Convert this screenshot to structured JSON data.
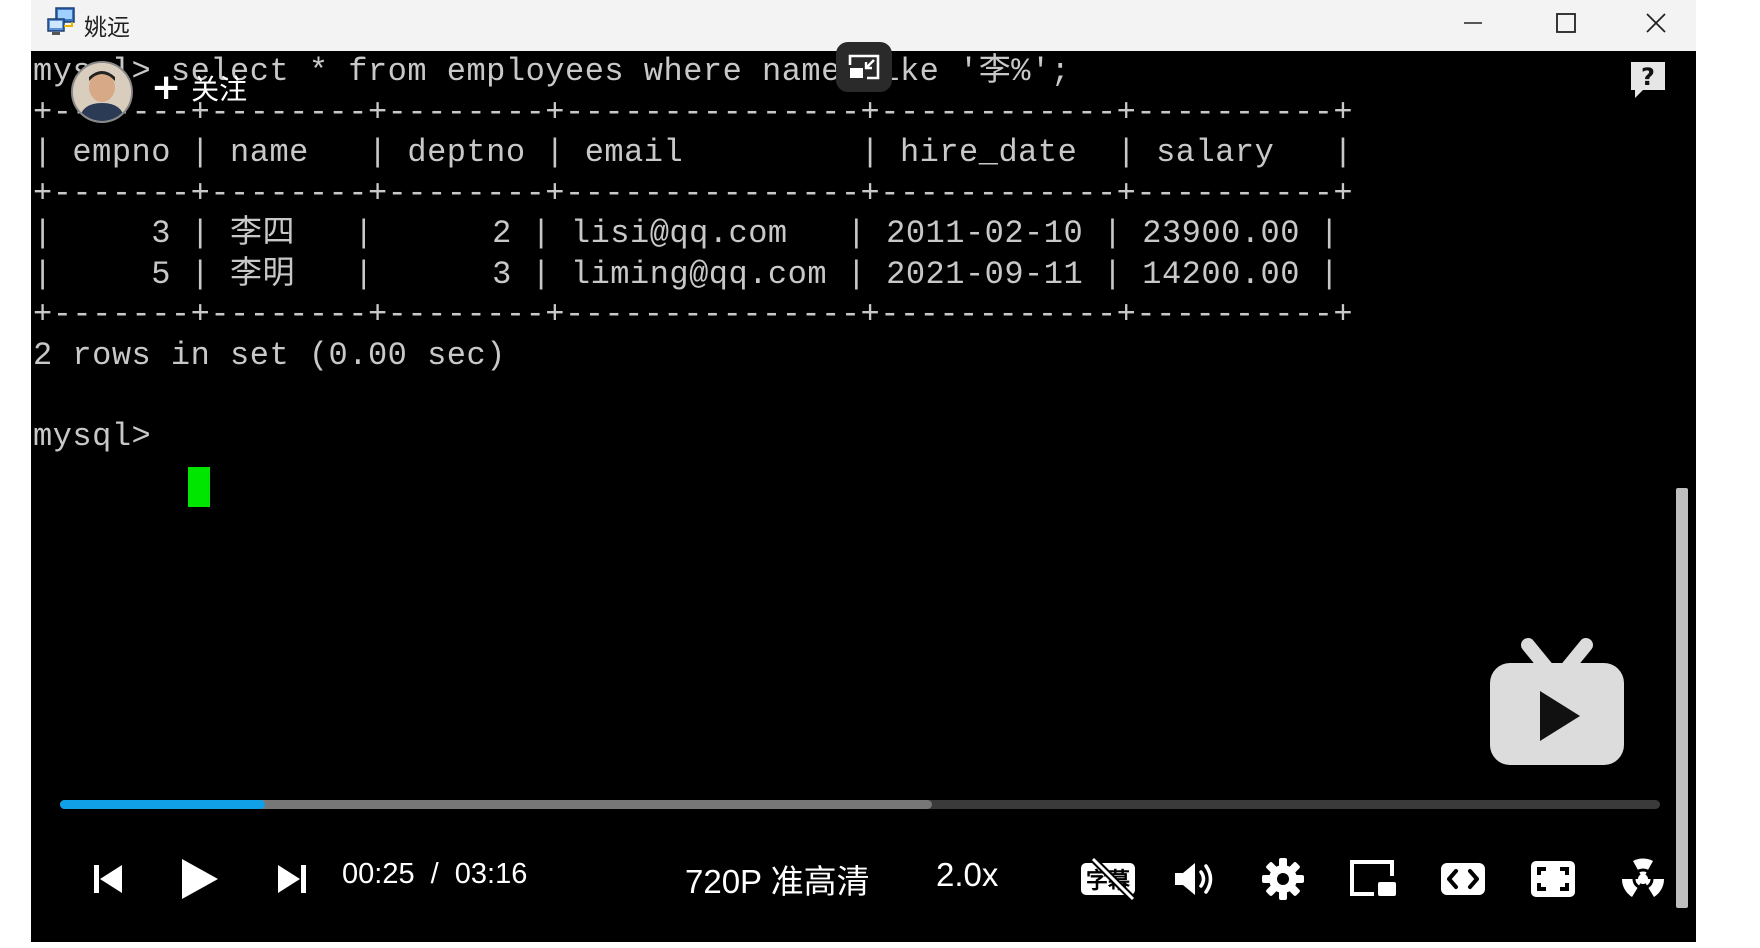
{
  "window": {
    "title": "姚远"
  },
  "terminal": {
    "lines": [
      "mysql> select * from employees where name like '李%';",
      "+-------+--------+--------+---------------+------------+----------+",
      "| empno | name   | deptno | email         | hire_date  | salary   |",
      "+-------+--------+--------+---------------+------------+----------+",
      "|     3 | 李四   |      2 | lisi@qq.com   | 2011-02-10 | 23900.00 |",
      "|     5 | 李明   |      3 | liming@qq.com | 2021-09-11 | 14200.00 |",
      "+-------+--------+--------+---------------+------------+----------+",
      "2 rows in set (0.00 sec)",
      "",
      "mysql> "
    ],
    "table": {
      "columns": [
        "empno",
        "name",
        "deptno",
        "email",
        "hire_date",
        "salary"
      ],
      "rows": [
        [
          "3",
          "李四",
          "2",
          "lisi@qq.com",
          "2011-02-10",
          "23900.00"
        ],
        [
          "5",
          "李明",
          "3",
          "liming@qq.com",
          "2021-09-11",
          "14200.00"
        ]
      ]
    }
  },
  "overlay": {
    "follow_label": "关注"
  },
  "player": {
    "current_time": "00:25",
    "separator": "/",
    "duration": "03:16",
    "quality": "720P 准高清",
    "speed": "2.0x",
    "played_fraction": 0.128,
    "buffered_fraction": 0.545,
    "accent_color": "#0fa0e8"
  },
  "icons": {
    "app": "network-computer-icon",
    "prev": "skip-previous-icon",
    "play": "play-icon",
    "next": "skip-next-icon",
    "subtitle": "subtitle-off-icon",
    "volume": "volume-icon",
    "settings": "gear-icon",
    "mini_player": "mini-player-icon",
    "widescreen": "widescreen-icon",
    "fullscreen": "fullscreen-icon",
    "radiation": "radiation-icon"
  }
}
